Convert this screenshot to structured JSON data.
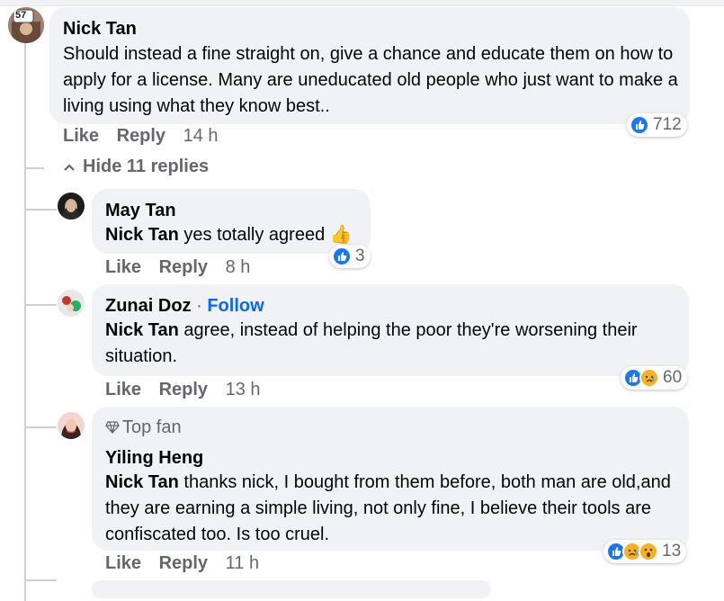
{
  "comments": [
    {
      "author": "Nick Tan",
      "badge": "57",
      "text": "Should instead a fine straight on, give a chance and educate them on how to apply for a license. Many are uneducated old people who just want to make a living using what they know best..",
      "like_label": "Like",
      "reply_label": "Reply",
      "time": "14 h",
      "reaction_count": "712",
      "hide_replies_label": "Hide 11 replies"
    },
    {
      "author": "May Tan",
      "mention": "Nick Tan",
      "text": " yes totally agreed 👍",
      "like_label": "Like",
      "reply_label": "Reply",
      "time": "8 h",
      "reaction_count": "3"
    },
    {
      "author": "Zunai Doz",
      "separator": " · ",
      "follow_label": "Follow",
      "mention": "Nick Tan",
      "text": " agree, instead of helping the poor they're worsening their situation.",
      "like_label": "Like",
      "reply_label": "Reply",
      "time": "13 h",
      "reaction_count": "60"
    },
    {
      "topfan_label": "Top fan",
      "author": "Yiling Heng",
      "mention": "Nick Tan",
      "text": " thanks nick, I bought from them before, both man are old,and they are earning a simple living, not only fine, I believe their tools are confiscated too. Is too cruel.",
      "like_label": "Like",
      "reply_label": "Reply",
      "time": "11 h",
      "reaction_count": "13"
    }
  ],
  "icons": {
    "hide_chevron": "chevron-up-icon",
    "topfan": "diamond-icon",
    "like": "like-reaction-icon",
    "care": "care-reaction-icon",
    "wow": "wow-reaction-icon"
  },
  "colors": {
    "bubble": "#f0f2f5",
    "secondary_text": "#65676b",
    "link_blue": "#0866ff",
    "like_blue": "#1877f2"
  }
}
